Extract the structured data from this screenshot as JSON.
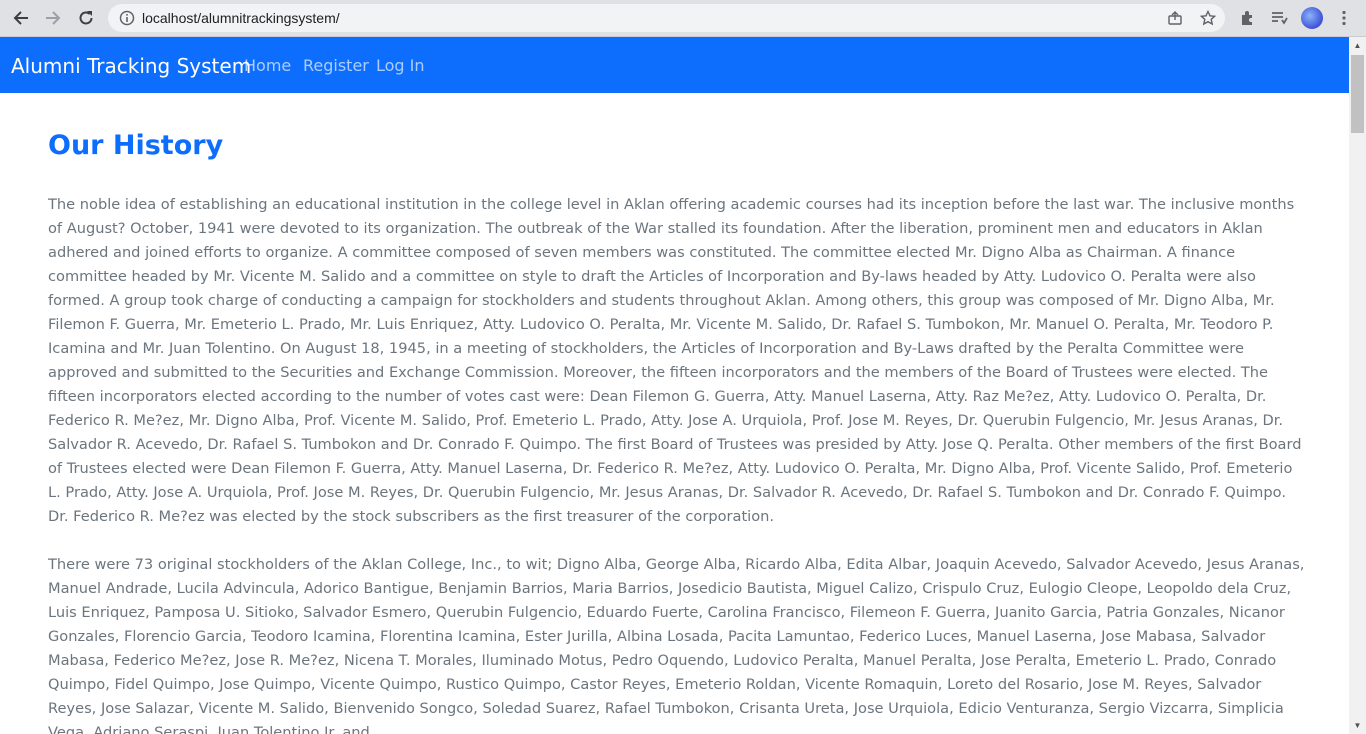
{
  "browser": {
    "url": "localhost/alumnitrackingsystem/"
  },
  "navbar": {
    "brand": "Alumni Tracking System",
    "links": [
      "Home",
      "Register",
      "Log In"
    ]
  },
  "main": {
    "title": "Our History",
    "paragraphs": [
      "The noble idea of establishing an educational institution in the college level in Aklan offering academic courses had its inception before the last war. The inclusive months of August? October, 1941 were devoted to its organization. The outbreak of the War stalled its foundation. After the liberation, prominent men and educators in Aklan adhered and joined efforts to organize. A committee composed of seven members was constituted. The committee elected Mr. Digno Alba as Chairman. A finance committee headed by Mr. Vicente M. Salido and a committee on style to draft the Articles of Incorporation and By-laws headed by Atty. Ludovico O. Peralta were also formed. A group took charge of conducting a campaign for stockholders and students throughout Aklan. Among others, this group was composed of Mr. Digno Alba, Mr. Filemon F. Guerra, Mr. Emeterio L. Prado, Mr. Luis Enriquez, Atty. Ludovico O. Peralta, Mr. Vicente M. Salido, Dr. Rafael S. Tumbokon, Mr. Manuel O. Peralta, Mr. Teodoro P. Icamina and Mr. Juan Tolentino. On August 18, 1945, in a meeting of stockholders, the Articles of Incorporation and By-Laws drafted by the Peralta Committee were approved and submitted to the Securities and Exchange Commission. Moreover, the fifteen incorporators and the members of the Board of Trustees were elected. The fifteen incorporators elected according to the number of votes cast were: Dean Filemon G. Guerra, Atty. Manuel Laserna, Atty. Raz Me?ez, Atty. Ludovico O. Peralta, Dr. Federico R. Me?ez, Mr. Digno Alba, Prof. Vicente M. Salido, Prof. Emeterio L. Prado, Atty. Jose A. Urquiola, Prof. Jose M. Reyes, Dr. Querubin Fulgencio, Mr. Jesus Aranas, Dr. Salvador R. Acevedo, Dr. Rafael S. Tumbokon and Dr. Conrado F. Quimpo. The first Board of Trustees was presided by Atty. Jose Q. Peralta. Other members of the first Board of Trustees elected were Dean Filemon F. Guerra, Atty. Manuel Laserna, Dr. Federico R. Me?ez, Atty. Ludovico O. Peralta, Mr. Digno Alba, Prof. Vicente Salido, Prof. Emeterio L. Prado, Atty. Jose A. Urquiola, Prof. Jose M. Reyes, Dr. Querubin Fulgencio, Mr. Jesus Aranas, Dr. Salvador R. Acevedo, Dr. Rafael S. Tumbokon and Dr. Conrado F. Quimpo. Dr. Federico R. Me?ez was elected by the stock subscribers as the first treasurer of the corporation.",
      "There were 73 original stockholders of the Aklan College, Inc., to wit; Digno Alba, George Alba, Ricardo Alba, Edita Albar, Joaquin Acevedo, Salvador Acevedo, Jesus Aranas, Manuel Andrade, Lucila Advincula, Adorico Bantigue, Benjamin Barrios, Maria Barrios, Josedicio Bautista, Miguel Calizo, Crispulo Cruz, Eulogio Cleope, Leopoldo dela Cruz, Luis Enriquez, Pamposa U. Sitioko, Salvador Esmero, Querubin Fulgencio, Eduardo Fuerte, Carolina Francisco, Filemeon F. Guerra, Juanito Garcia, Patria Gonzales, Nicanor Gonzales, Florencio Garcia, Teodoro Icamina, Florentina Icamina, Ester Jurilla, Albina Losada, Pacita Lamuntao, Federico Luces, Manuel Laserna, Jose Mabasa, Salvador Mabasa, Federico Me?ez, Jose R. Me?ez, Nicena T. Morales, Iluminado Motus, Pedro Oquendo, Ludovico Peralta, Manuel Peralta, Jose Peralta, Emeterio L. Prado, Conrado Quimpo, Fidel Quimpo, Jose Quimpo, Vicente Quimpo, Rustico Quimpo, Castor Reyes, Emeterio Roldan, Vicente Romaquin, Loreto del Rosario, Jose M. Reyes, Salvador Reyes, Jose Salazar, Vicente M. Salido, Bienvenido Songco, Soledad Suarez, Rafael Tumbokon, Crisanta Ureta, Jose Urquiola, Edicio Venturanza, Sergio Vizcarra, Simplicia Vega, Adriano Seraspi, Juan Tolentino Jr. and"
    ]
  },
  "icons": [
    "back-icon",
    "forward-icon",
    "reload-icon",
    "info-icon",
    "share-icon",
    "star-icon",
    "extensions-icon",
    "reading-list-icon",
    "profile-avatar",
    "menu-icon"
  ],
  "colors": {
    "navbar": "#0d6efd",
    "title": "#0d6efd",
    "body_text": "#6c757d"
  }
}
